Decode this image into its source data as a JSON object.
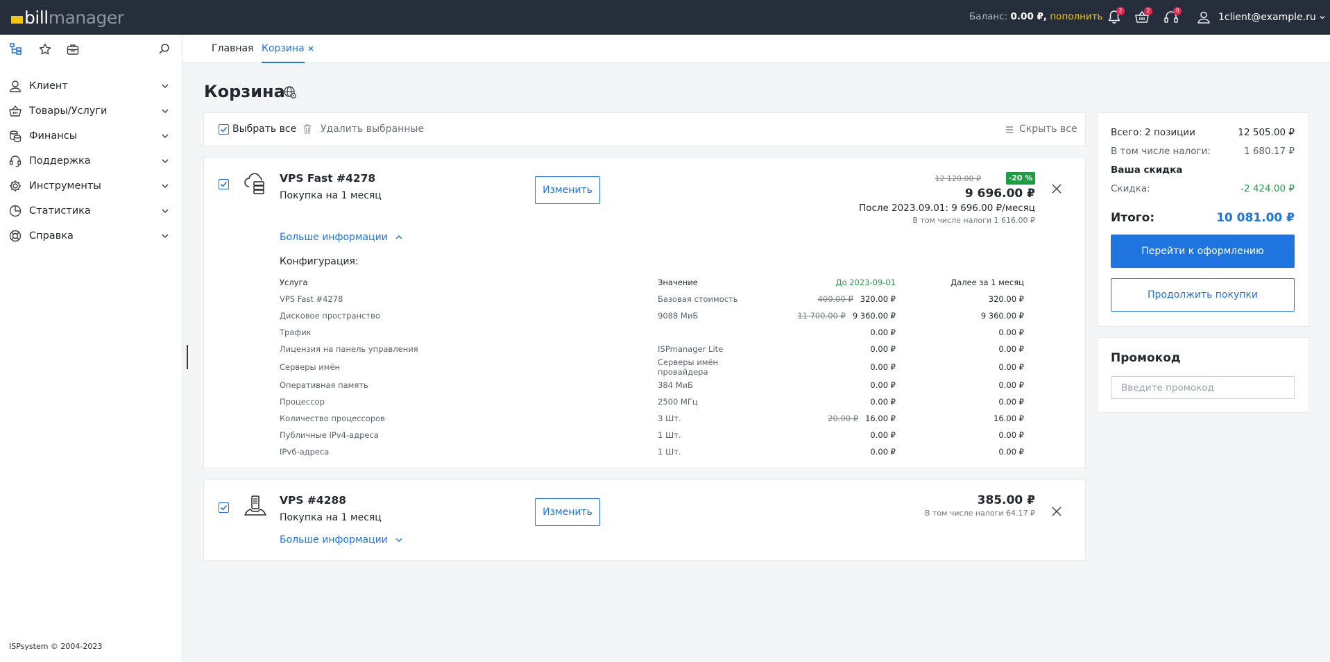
{
  "app": {
    "logo_bill": "bill",
    "logo_manager": "manager",
    "balance_label": "Баланс:",
    "balance_amount": "0.00 ₽,",
    "topup_label": "пополнить",
    "notifications_count": "2",
    "cart_count": "2",
    "support_count": "0",
    "user_email": "1client@example.ru"
  },
  "tabs": [
    {
      "label": "Главная"
    },
    {
      "label": "Корзина"
    }
  ],
  "sidebar": {
    "items": [
      {
        "label": "Клиент",
        "icon": "user-icon"
      },
      {
        "label": "Товары/Услуги",
        "icon": "basket-icon"
      },
      {
        "label": "Финансы",
        "icon": "coins-icon"
      },
      {
        "label": "Поддержка",
        "icon": "headset-icon"
      },
      {
        "label": "Инструменты",
        "icon": "gear-icon"
      },
      {
        "label": "Статистика",
        "icon": "pie-chart-icon"
      },
      {
        "label": "Справка",
        "icon": "lifebuoy-icon"
      }
    ],
    "copyright": "ISPsystem © 2004-2023"
  },
  "page": {
    "title": "Корзина"
  },
  "toolbar": {
    "select_all": "Выбрать все",
    "delete_selected": "Удалить выбранные",
    "hide_all": "Скрыть все"
  },
  "items": [
    {
      "name": "VPS Fast #4278",
      "subtitle": "Покупка на 1 месяц",
      "edit_label": "Изменить",
      "old_price": "12 120.00 ₽",
      "discount": "-20 %",
      "price": "9 696.00 ₽",
      "after": "После 2023.09.01: 9 696.00 ₽/месяц",
      "tax": "В том числе налоги 1 616.00 ₽",
      "more_label": "Больше информации",
      "config_title": "Конфигурация:",
      "config_headers": {
        "service": "Услуга",
        "value": "Значение",
        "until": "До 2023-09-01",
        "next": "Далее за 1 месяц"
      },
      "config_rows": [
        {
          "service": "VPS Fast #4278",
          "value": "Базовая стоимость",
          "old": "400.00 ₽",
          "until": "320.00 ₽",
          "next": "320.00 ₽"
        },
        {
          "service": "Дисковое пространство",
          "value": "9088 МиБ",
          "old": "11 700.00 ₽",
          "until": "9 360.00 ₽",
          "next": "9 360.00 ₽"
        },
        {
          "service": "Трафик",
          "value": "",
          "old": "",
          "until": "0.00 ₽",
          "next": "0.00 ₽"
        },
        {
          "service": "Лицензия на панель управления",
          "value": "ISPmanager Lite",
          "old": "",
          "until": "0.00 ₽",
          "next": "0.00 ₽"
        },
        {
          "service": "Серверы имён",
          "value": "Серверы имён провайдера",
          "old": "",
          "until": "0.00 ₽",
          "next": "0.00 ₽"
        },
        {
          "service": "Оперативная память",
          "value": "384 МиБ",
          "old": "",
          "until": "0.00 ₽",
          "next": "0.00 ₽"
        },
        {
          "service": "Процессор",
          "value": "2500 МГц",
          "old": "",
          "until": "0.00 ₽",
          "next": "0.00 ₽"
        },
        {
          "service": "Количество процессоров",
          "value": "3 Шт.",
          "old": "20.00 ₽",
          "until": "16.00 ₽",
          "next": "16.00 ₽"
        },
        {
          "service": "Публичные IPv4-адреса",
          "value": "1 Шт.",
          "old": "",
          "until": "0.00 ₽",
          "next": "0.00 ₽"
        },
        {
          "service": "IPv6-адреса",
          "value": "1 Шт.",
          "old": "",
          "until": "0.00 ₽",
          "next": "0.00 ₽"
        }
      ]
    },
    {
      "name": "VPS #4288",
      "subtitle": "Покупка на 1 месяц",
      "edit_label": "Изменить",
      "price": "385.00 ₽",
      "tax": "В том числе налоги 64.17 ₽",
      "more_label": "Больше информации"
    }
  ],
  "summary": {
    "total_positions_label": "Всего: 2 позиции",
    "total_positions_value": "12 505.00 ₽",
    "taxes_label": "В том числе налоги:",
    "taxes_value": "1 680.17 ₽",
    "your_discount": "Ваша скидка",
    "discount_label": "Скидка:",
    "discount_value": "-2 424.00 ₽",
    "total_label": "Итого:",
    "total_value": "10 081.00 ₽",
    "checkout_label": "Перейти к оформлению",
    "continue_label": "Продолжить покупки"
  },
  "promo": {
    "title": "Промокод",
    "placeholder": "Введите промокод"
  },
  "colors": {
    "accent": "#1f74e0",
    "topbar": "#252e3a",
    "brand_yellow": "#f3c510",
    "discount_green": "#1e9d45",
    "badge_red": "#e5284f"
  }
}
